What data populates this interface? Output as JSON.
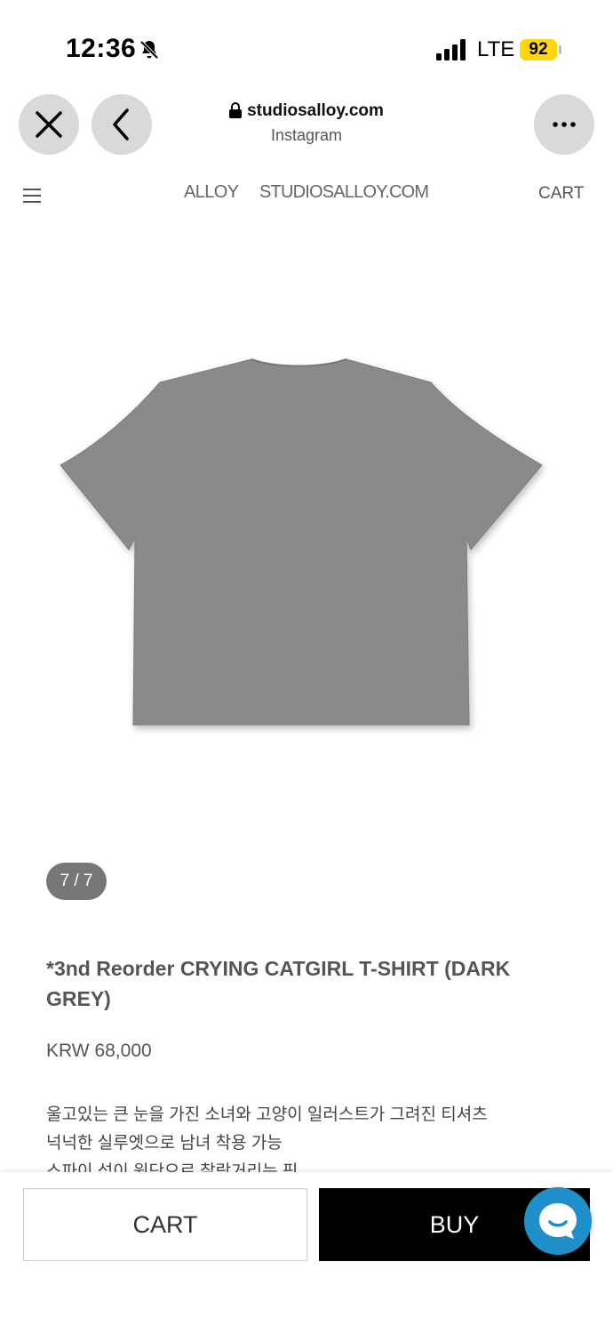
{
  "status_bar": {
    "time": "12:36",
    "network": "LTE",
    "battery": "92",
    "battery_color": "#ffd60a"
  },
  "browser": {
    "url": "studiosalloy.com",
    "source": "Instagram",
    "icons": [
      "close-icon",
      "back-icon",
      "more-icon",
      "lock-icon"
    ]
  },
  "header": {
    "brand": "ALLOY",
    "site": "STUDIOSALLOY.COM",
    "cart": "CART"
  },
  "gallery": {
    "counter": "7 / 7",
    "product_color": "#8a8a8a"
  },
  "product": {
    "title": "*3nd Reorder CRYING CATGIRL T-SHIRT (DARK GREY)",
    "price": "KRW 68,000",
    "description": [
      "울고있는 큰 눈을 가진 소녀와 고양이 일러스트가 그려진 티셔츠",
      "넉넉한 실루엣으로 남녀 착용 가능",
      "스파이 섬이 원단으로 찰랑거리는 핏"
    ]
  },
  "actions": {
    "cart": "CART",
    "buy": "BUY",
    "chat_color": "#1f8fc9"
  }
}
